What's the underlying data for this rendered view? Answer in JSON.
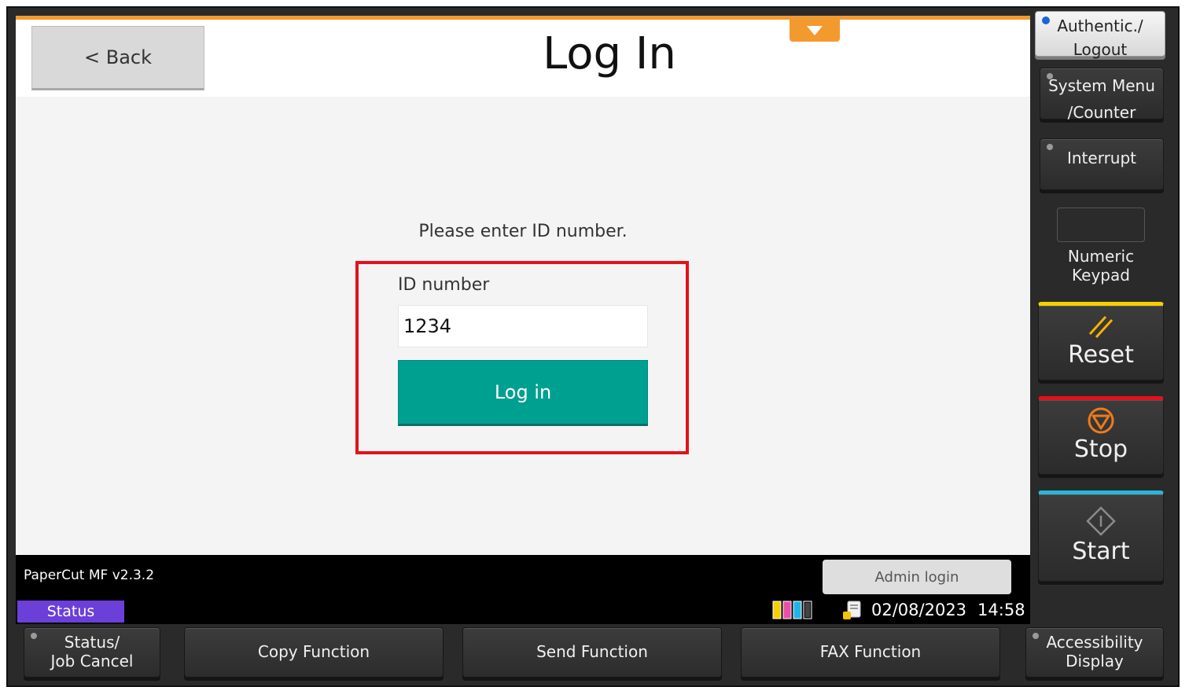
{
  "screen": {
    "back_label": "< Back",
    "title": "Log In",
    "prompt": "Please enter ID number.",
    "id_field": {
      "label": "ID number",
      "value": "1234"
    },
    "login_button": "Log in",
    "accent_color": "#00a091",
    "highlight_color": "#e3111b"
  },
  "status_bar": {
    "app_version": "PaperCut MF v2.3.2",
    "status_tab": "Status",
    "admin_login": "Admin login",
    "date": "02/08/2023",
    "time": "14:58",
    "icons": [
      "toner-level-icon",
      "storage-icon"
    ]
  },
  "hardware_panel": {
    "authentic": {
      "line1": "Authentic./",
      "line2": "Logout"
    },
    "system_menu": {
      "line1": "System Menu",
      "line2": "/Counter"
    },
    "interrupt": "Interrupt",
    "keypad": {
      "line1": "Numeric",
      "line2": "Keypad"
    },
    "reset": "Reset",
    "stop": "Stop",
    "start": "Start"
  },
  "function_keys": {
    "status": {
      "line1": "Status/",
      "line2": "Job Cancel"
    },
    "copy": "Copy Function",
    "send": "Send Function",
    "fax": "FAX Function",
    "accessibility": {
      "line1": "Accessibility",
      "line2": "Display"
    }
  }
}
